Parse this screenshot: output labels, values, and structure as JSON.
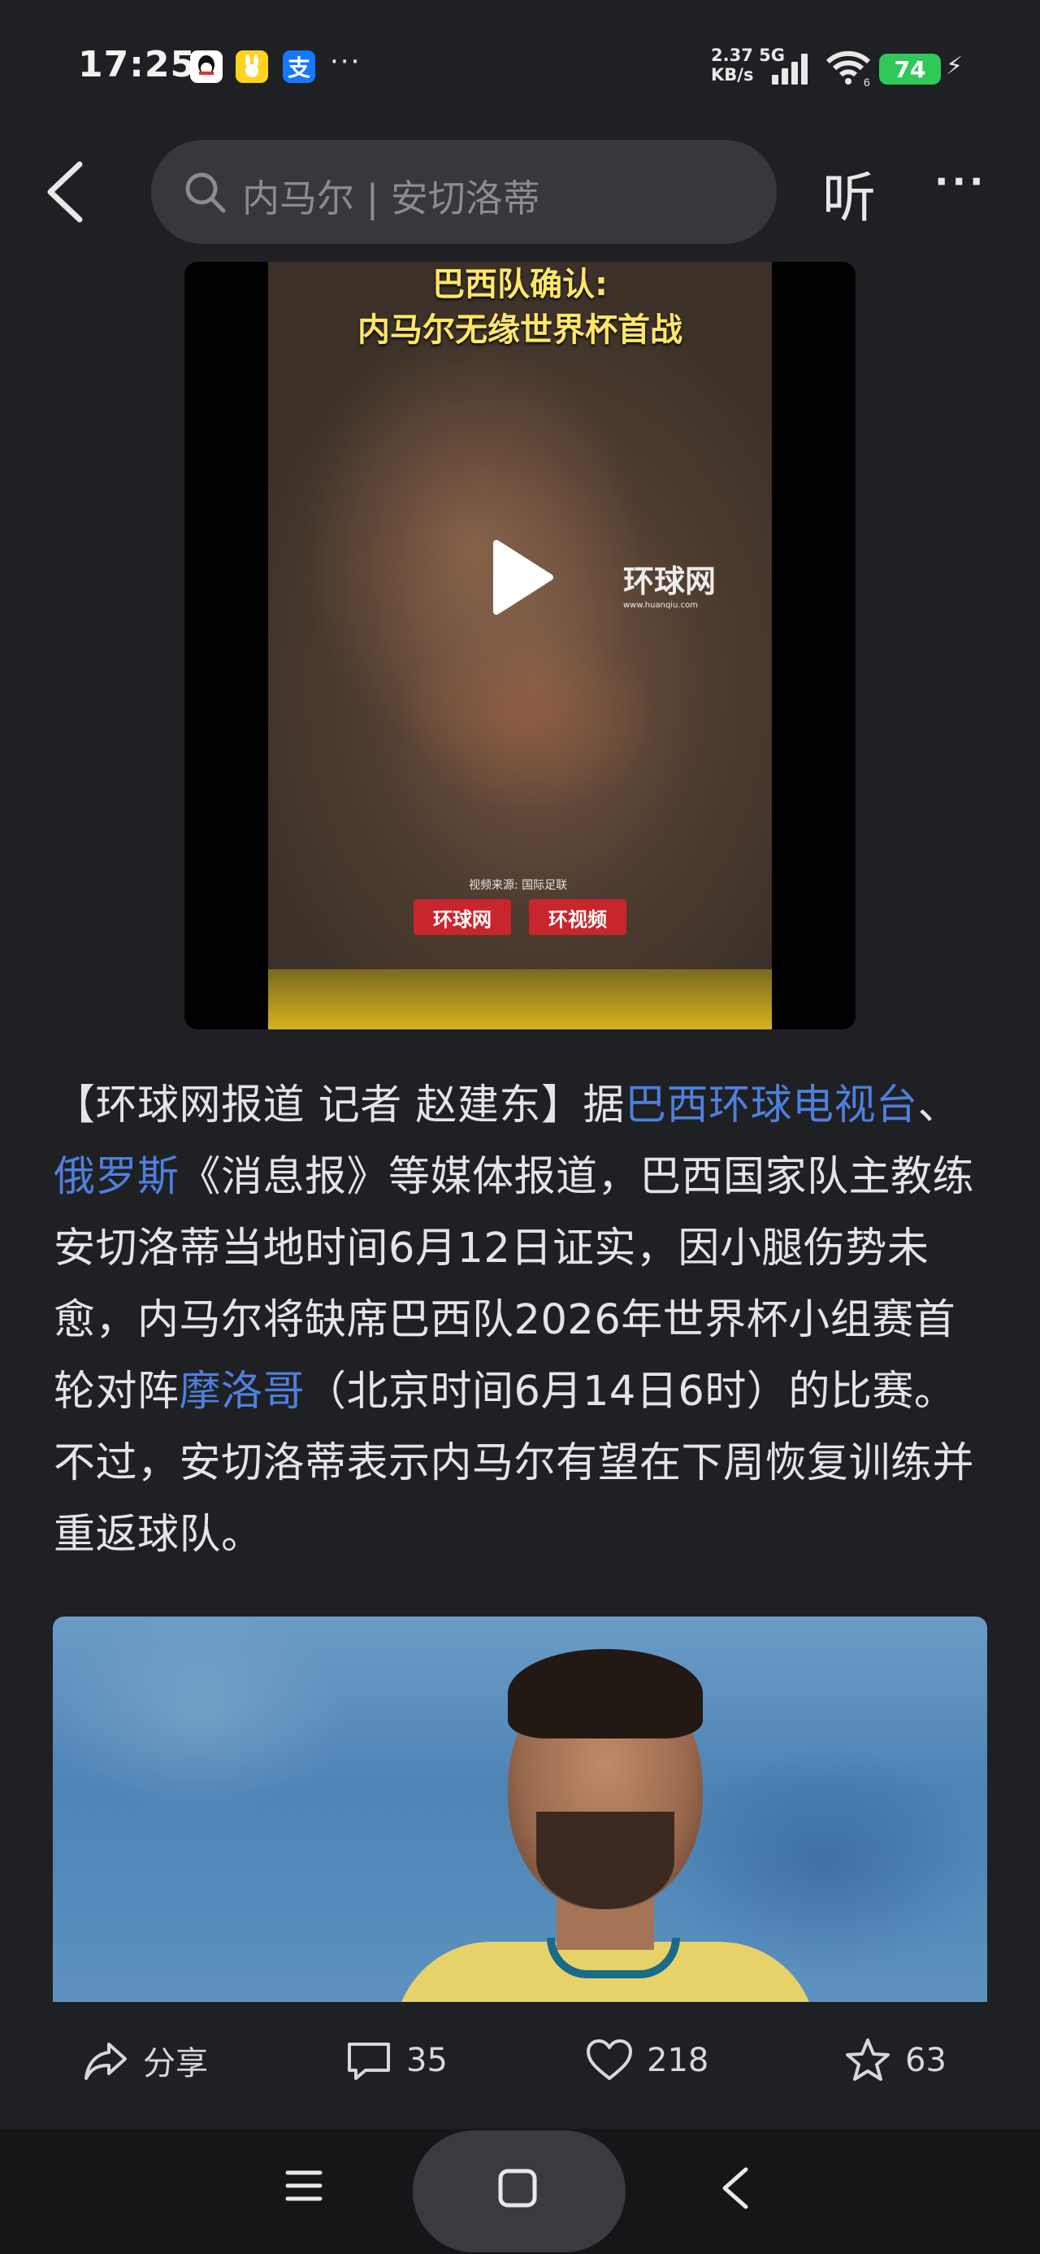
{
  "status_bar": {
    "time": "17:25",
    "net_speed_value": "2.37",
    "net_speed_unit": "KB/s",
    "network_type": "5G",
    "battery": "74",
    "wifi_label": "6",
    "notif_icons": [
      "qq-icon",
      "rabbit-app-icon",
      "alipay-icon"
    ],
    "more": "···"
  },
  "nav": {
    "search_placeholder": "内马尔 | 安切洛蒂",
    "listen_label": "听",
    "more": "···"
  },
  "video": {
    "title_line1": "巴西队确认:",
    "title_line2": "内马尔无缘世界杯首战",
    "watermark": "环球网",
    "watermark_url": "www.huanqiu.com",
    "source": "视频来源: 国际足联",
    "badge_left": "环球网",
    "badge_right": "环视频"
  },
  "article": {
    "p1": "【环球网报道 记者 赵建东】据",
    "link1": "巴西环球电视台",
    "p2": "、",
    "link2": "俄罗斯",
    "p3": "《消息报》等媒体报道，巴西国家队主教练安切洛蒂当地时间6月12日证实，因小腿伤势未愈，内马尔将缺席巴西队2026年世界杯小组赛首轮对阵",
    "link3": "摩洛哥",
    "p4": "（北京时间6月14日6时）的比赛。不过，安切洛蒂表示内马尔有望在下周恢复训练并重返球队。"
  },
  "actions": {
    "share_label": "分享",
    "comment_count": "35",
    "like_count": "218",
    "favorite_count": "63"
  },
  "colors": {
    "background": "#1f2023",
    "link": "#4f7fdc",
    "battery": "#31c85a"
  }
}
